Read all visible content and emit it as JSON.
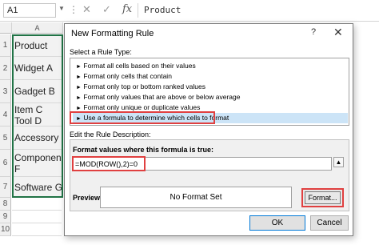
{
  "formula_bar": {
    "name_box": "A1",
    "more": "⋮",
    "cancel_glyph": "✕",
    "enter_glyph": "✓",
    "fx_glyph": "fx",
    "content": "Product"
  },
  "sheet": {
    "column_header": "A",
    "row_numbers": [
      "1",
      "2",
      "3",
      "4",
      "5",
      "6",
      "7",
      "8",
      "9",
      "10"
    ],
    "cells": [
      "Product",
      "Widget A",
      "Gadget B",
      "Item C",
      "Tool D",
      "Accessory E",
      "Component F",
      "Software G"
    ]
  },
  "dialog": {
    "title": "New Formatting Rule",
    "help": "?",
    "close": "✕",
    "select_rule_type_label": "Select a Rule Type:",
    "rule_types": [
      "Format all cells based on their values",
      "Format only cells that contain",
      "Format only top or bottom ranked values",
      "Format only values that are above or below average",
      "Format only unique or duplicate values",
      "Use a formula to determine which cells to format"
    ],
    "selected_rule_index": 5,
    "edit_rule_label": "Edit the Rule Description:",
    "formula_label": "Format values where this formula is true:",
    "formula_value": "=MOD(ROW(),2)=0",
    "preview_label": "Preview:",
    "preview_text": "No Format Set",
    "format_button": "Format...",
    "ok_button": "OK",
    "cancel_button": "Cancel"
  },
  "colors": {
    "highlight": "#e04040",
    "selection_fill": "#cce4f7",
    "excel_green": "#217346"
  }
}
